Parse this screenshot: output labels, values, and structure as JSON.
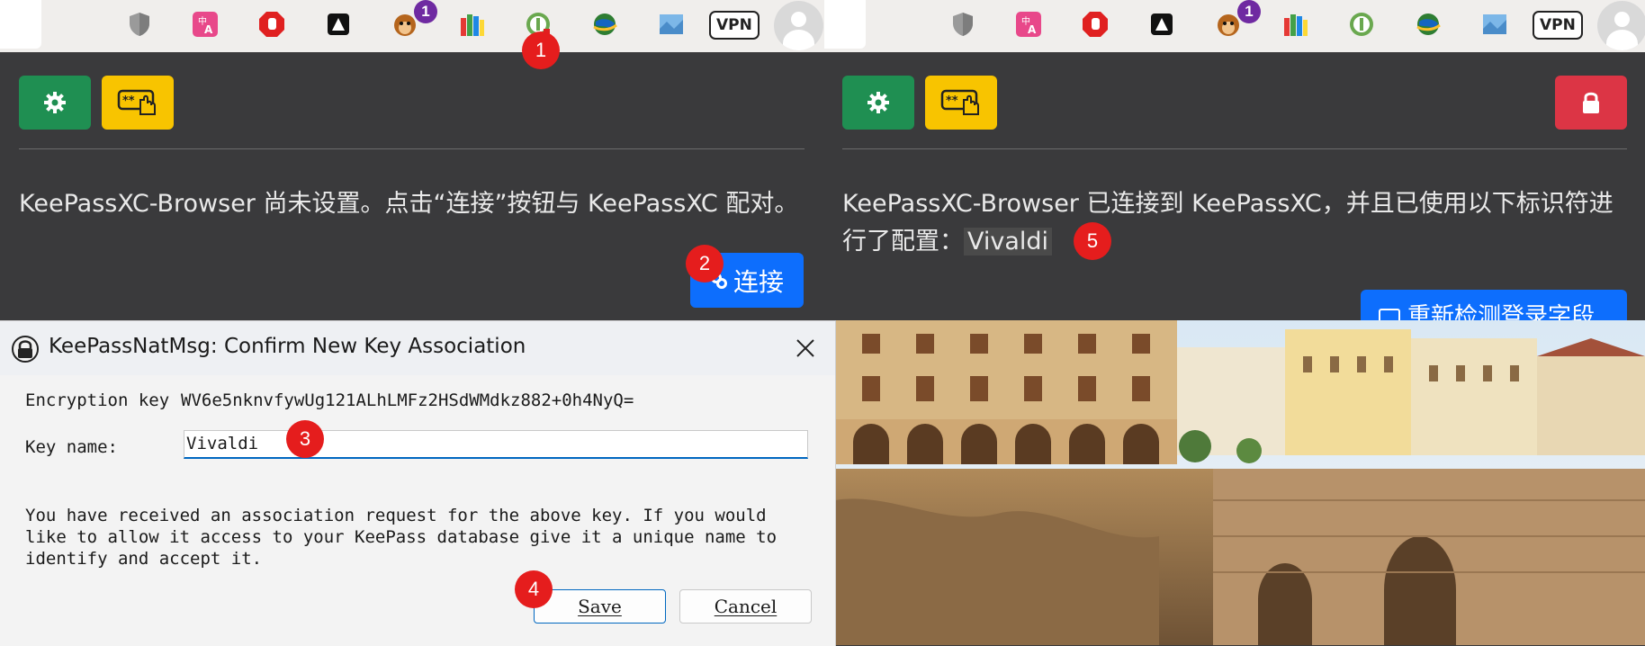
{
  "toolbar": {
    "notification_badge": "1",
    "vpn_label": "VPN",
    "extensions": [
      "shield-icon",
      "translate-icon",
      "stop-hand-icon",
      "tab-icon",
      "monkey-icon",
      "bottles-icon",
      "keepassxc-icon",
      "globe-icon",
      "map-icon",
      "vpn-icon",
      "profile-icon"
    ]
  },
  "left_popup": {
    "message": "KeePassXC-Browser 尚未设置。点击“连接”按钮与 KeePassXC 配对。",
    "connect_label": "连接"
  },
  "right_popup": {
    "message_prefix": "KeePassXC-Browser 已连接到 KeePassXC，并且已使用以下标识符进行了配置：",
    "identifier": "Vivaldi",
    "redetect_label": "重新检测登录字段"
  },
  "dialog": {
    "title": "KeePassNatMsg: Confirm New Key Association",
    "encryption_key_label": "Encryption key",
    "encryption_key_value": "WV6e5nknvfywUg121ALhLMFz2HSdWMdkz882+0h4NyQ=",
    "key_name_label": "Key name:",
    "key_name_value": "Vivaldi",
    "body": "You have received an association request for the above key. If you would like to allow it access to your KeePass database give it a unique name to identify and accept it.",
    "save_label": "Save",
    "cancel_label": "Cancel"
  },
  "steps": [
    "1",
    "2",
    "3",
    "4",
    "5"
  ],
  "colors": {
    "green": "#1f8f52",
    "yellow": "#f8c400",
    "red": "#dc3545",
    "blue": "#0d6efd",
    "step_red": "#e51d1d",
    "popup_bg": "#3a3a3c"
  }
}
